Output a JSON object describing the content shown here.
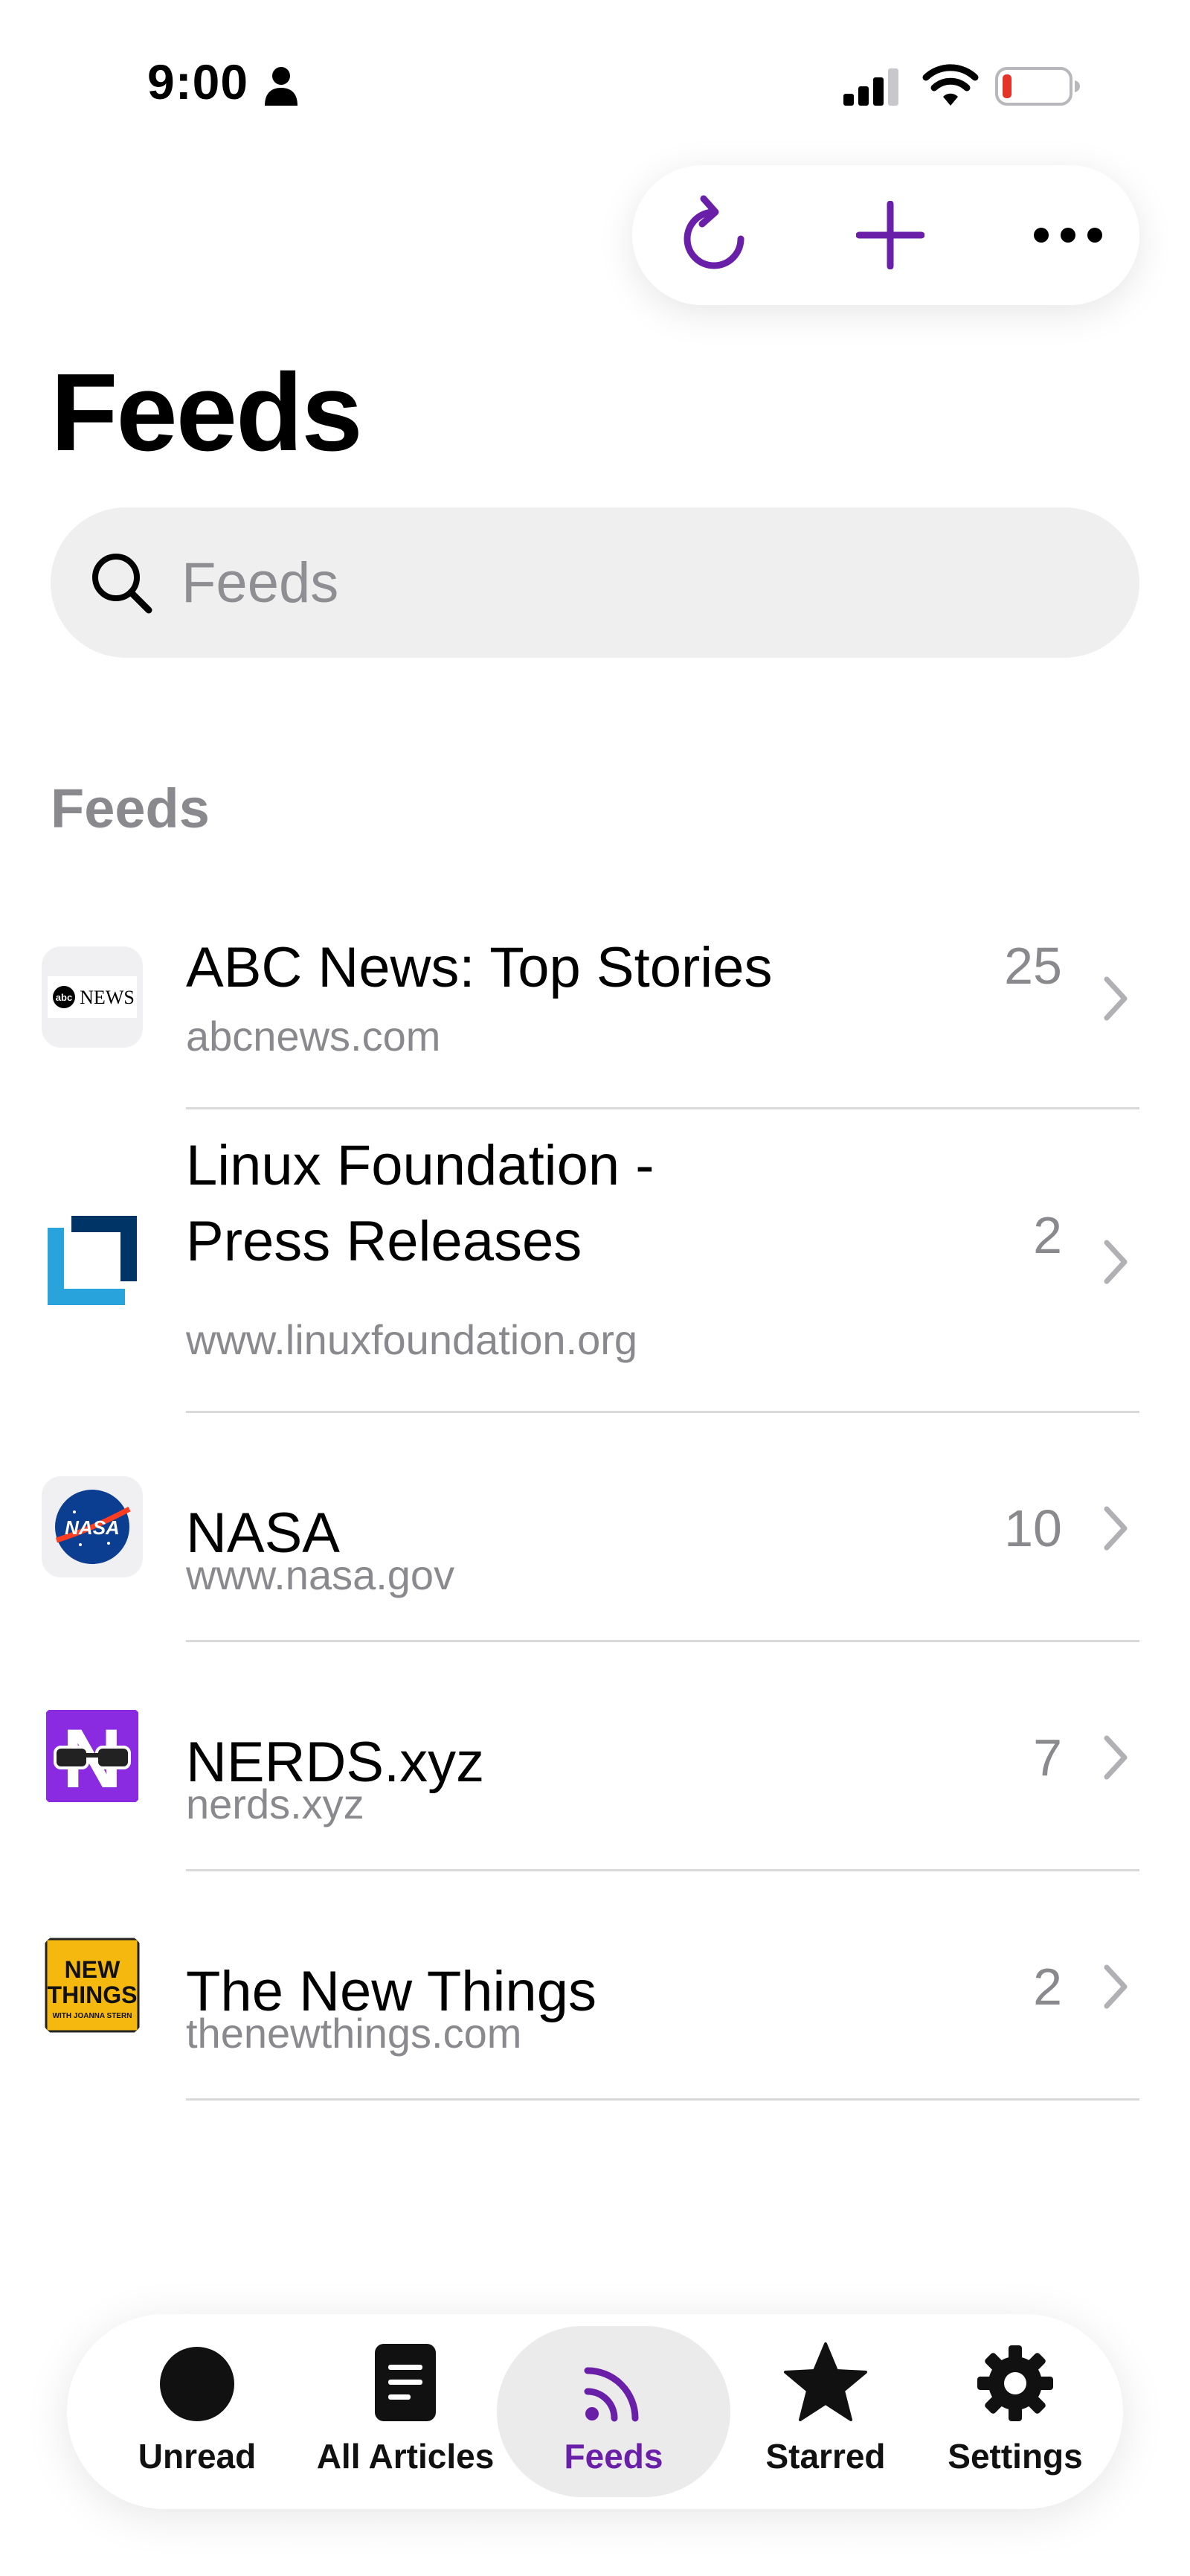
{
  "status_bar": {
    "time": "9:00",
    "icons": [
      "person-icon",
      "cellular-signal-icon",
      "wifi-icon",
      "battery-low-icon"
    ]
  },
  "toolbar": {
    "buttons": [
      "refresh-icon",
      "add-icon",
      "more-icon"
    ]
  },
  "colors": {
    "accent": "#6a1fa8",
    "secondary_text": "#8a8a8e",
    "search_background": "#efefef",
    "battery_low": "#e5332a"
  },
  "page": {
    "title": "Feeds"
  },
  "search": {
    "placeholder": "Feeds",
    "value": ""
  },
  "feeds_section": {
    "header": "Feeds",
    "items": [
      {
        "title": "ABC News: Top Stories",
        "url": "abcnews.com",
        "count": "25",
        "logo_text": "NEWS"
      },
      {
        "title": "Linux Foundation -",
        "title_line2": "Press Releases",
        "url": "www.linuxfoundation.org",
        "count": "2"
      },
      {
        "title": "NASA",
        "url": "www.nasa.gov",
        "count": "10",
        "logo_text": "NASA"
      },
      {
        "title": "NERDS.xyz",
        "url": "nerds.xyz",
        "count": "7",
        "logo_text": "N"
      },
      {
        "title": "The New Things",
        "url": "thenewthings.com",
        "count": "2",
        "logo_text": "NEW THINGS",
        "logo_subtext": "WITH JOANNA STERN"
      }
    ]
  },
  "tab_bar": {
    "tabs": [
      {
        "label": "Unread",
        "icon": "unread-dot-icon"
      },
      {
        "label": "All Articles",
        "icon": "document-icon"
      },
      {
        "label": "Feeds",
        "icon": "rss-icon",
        "selected": true
      },
      {
        "label": "Starred",
        "icon": "star-icon"
      },
      {
        "label": "Settings",
        "icon": "gear-icon"
      }
    ]
  }
}
